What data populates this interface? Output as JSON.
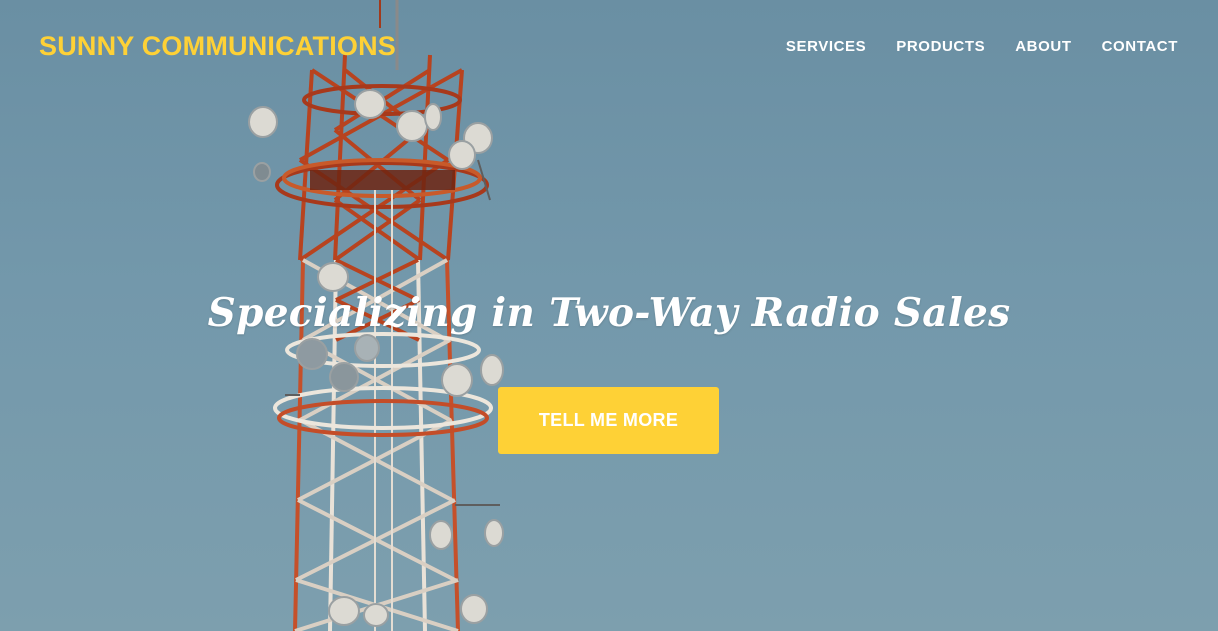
{
  "brand": {
    "name": "SUNNY COMMUNICATIONS",
    "color": "#fed136"
  },
  "nav": {
    "items": [
      {
        "label": "SERVICES"
      },
      {
        "label": "PRODUCTS"
      },
      {
        "label": "ABOUT"
      },
      {
        "label": "CONTACT"
      }
    ]
  },
  "hero": {
    "background": "photo of red and white telecom tower with antennas against blue sky",
    "headline": "Specializing in Two-Way Radio Sales",
    "cta_label": "TELL ME MORE",
    "cta_color": "#fed136"
  }
}
